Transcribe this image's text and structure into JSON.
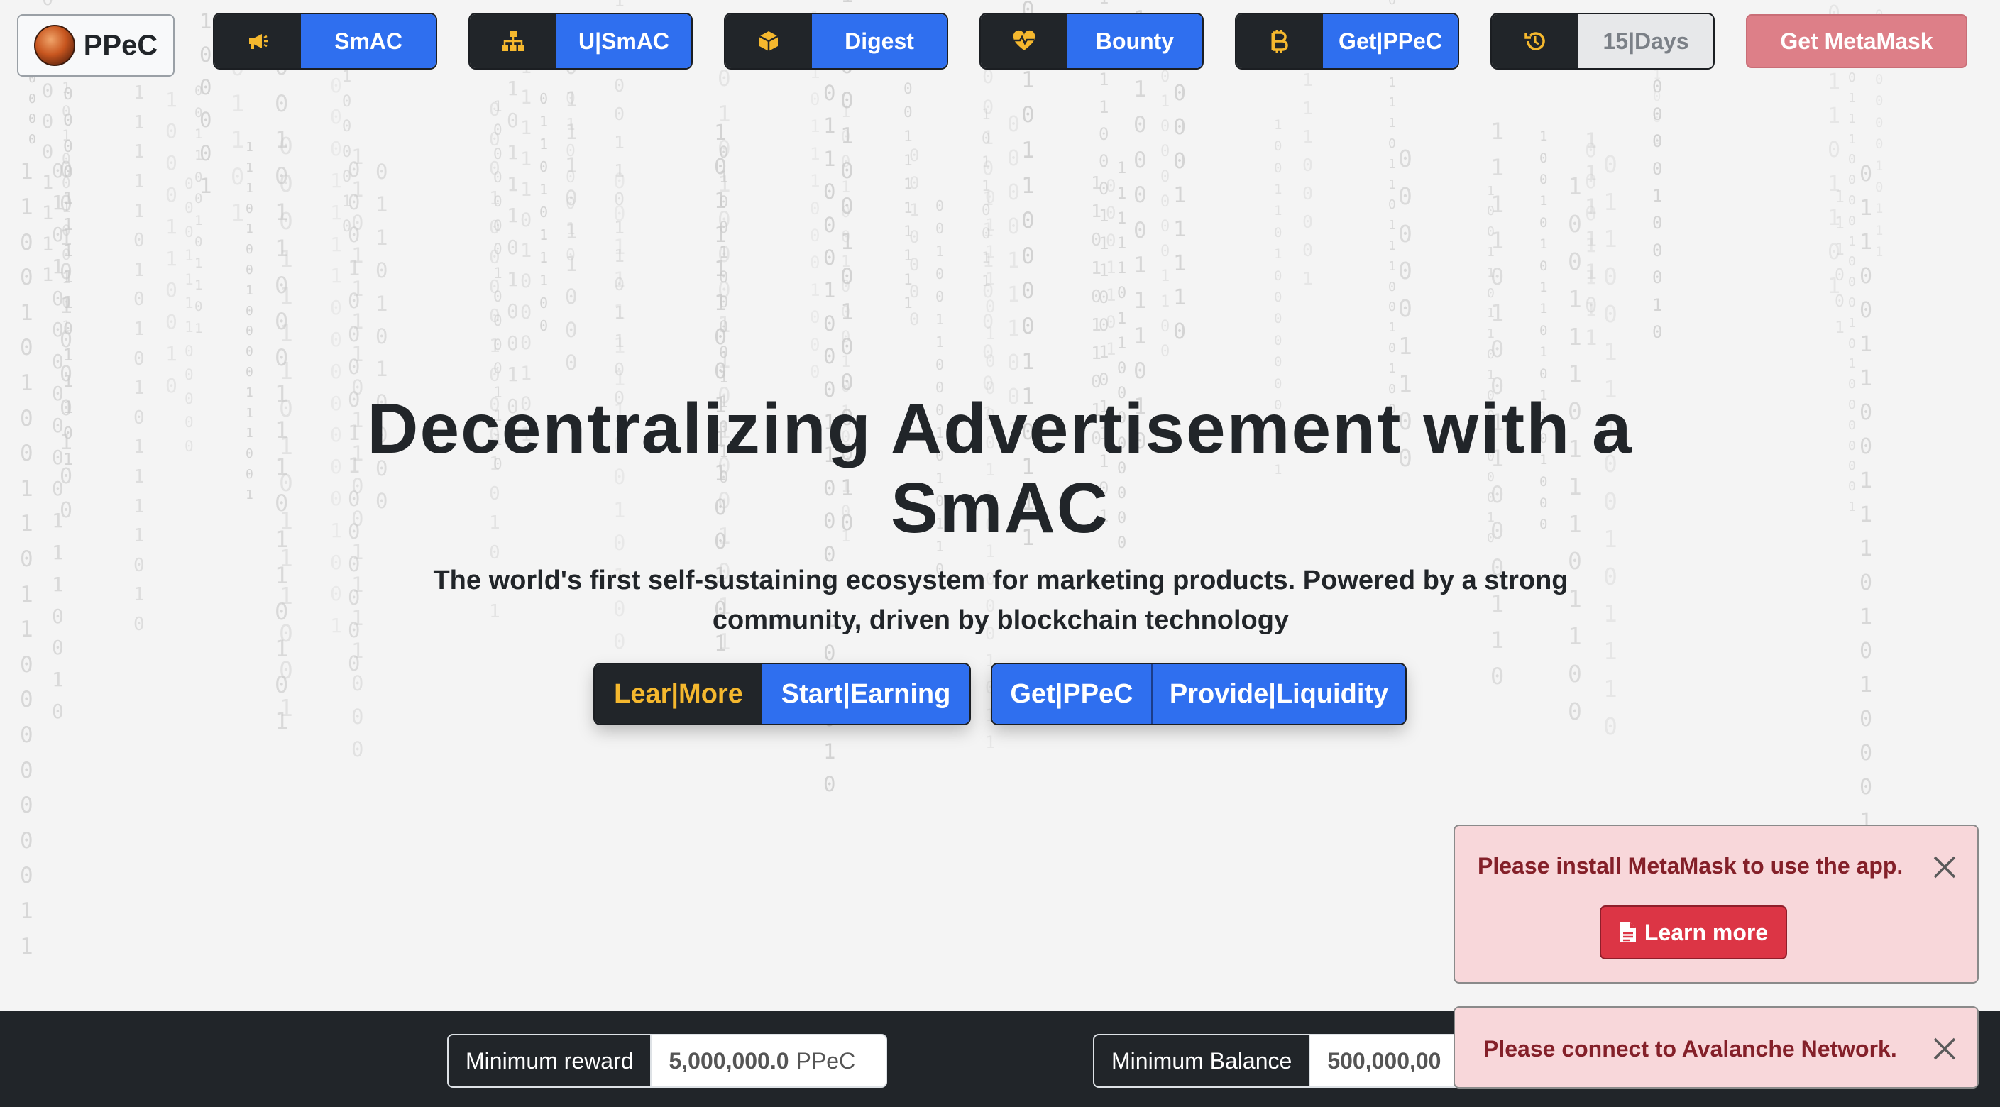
{
  "brand": {
    "name": "PPeC"
  },
  "nav": {
    "items": [
      {
        "icon": "megaphone-icon",
        "label": "SmAC"
      },
      {
        "icon": "sitemap-icon",
        "label": "U|SmAC"
      },
      {
        "icon": "cube-icon",
        "label": "Digest"
      },
      {
        "icon": "heartbeat-icon",
        "label": "Bounty"
      },
      {
        "icon": "bitcoin-icon",
        "label": "Get|PPeC"
      },
      {
        "icon": "history-icon",
        "label": "15|Days"
      }
    ],
    "metamask_label": "Get MetaMask"
  },
  "hero": {
    "title_line1": "Decentralizing Advertisement with a",
    "title_line2": "SmAC",
    "subtitle": "The world's first self-sustaining ecosystem for marketing products. Powered by a strong community, driven by blockchain technology",
    "cta_left": {
      "learn": "Lear|More",
      "start": "Start|Earning"
    },
    "cta_right": {
      "get": "Get|PPeC",
      "provide": "Provide|Liquidity"
    }
  },
  "footer": {
    "min_reward": {
      "label": "Minimum reward",
      "value": "5,000,000.0",
      "unit": "PPeC"
    },
    "min_balance": {
      "label": "Minimum Balance",
      "value": "500,000,00"
    }
  },
  "toasts": {
    "metamask": {
      "message": "Please install MetaMask to use the app.",
      "button": "Learn more"
    },
    "network": {
      "message": "Please connect to Avalanche Network."
    }
  },
  "colors": {
    "primary": "#2f6fef",
    "dark": "#212529",
    "accent_yellow": "#f5b82e",
    "danger": "#dc3545",
    "danger_light": "#f8d7da",
    "metamask_btn": "#dd7f88"
  }
}
